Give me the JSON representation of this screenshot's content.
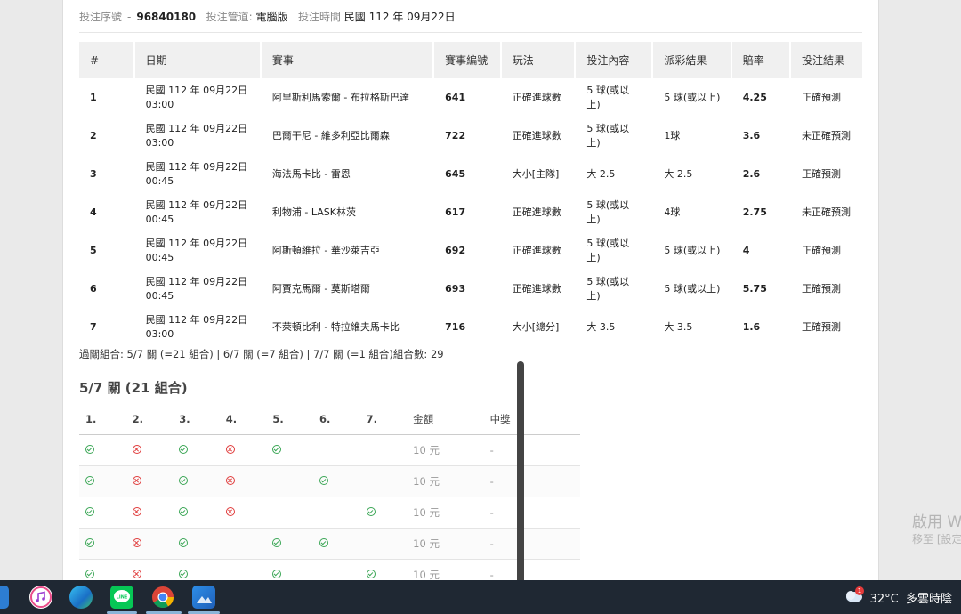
{
  "meta": {
    "bet_no_label": "投注序號",
    "bet_no": "96840180",
    "channel_label": "投注管道",
    "channel": "電腦版",
    "time_label": "投注時間",
    "time": "民國 112 年 09月22日"
  },
  "table": {
    "headers": [
      "#",
      "日期",
      "賽事",
      "賽事編號",
      "玩法",
      "投注內容",
      "派彩結果",
      "賠率",
      "投注結果"
    ],
    "rows": [
      {
        "n": "1",
        "date": "民國 112 年 09月22日",
        "time": "03:00",
        "match": "阿里斯利馬索爾 - 布拉格斯巴達",
        "code": "641",
        "play": "正確進球數",
        "pick": "5 球(或以上)",
        "result": "5 球(或以上)",
        "odds": "4.25",
        "outcome": "正確預測"
      },
      {
        "n": "2",
        "date": "民國 112 年 09月22日",
        "time": "03:00",
        "match": "巴爾干尼 - 維多利亞比爾森",
        "code": "722",
        "play": "正確進球數",
        "pick": "5 球(或以上)",
        "result": "1球",
        "odds": "3.6",
        "outcome": "未正確預測"
      },
      {
        "n": "3",
        "date": "民國 112 年 09月22日",
        "time": "00:45",
        "match": "海法馬卡比 - 雷恩",
        "code": "645",
        "play": "大小[主隊]",
        "pick": "大 2.5",
        "result": "大 2.5",
        "odds": "2.6",
        "outcome": "正確預測"
      },
      {
        "n": "4",
        "date": "民國 112 年 09月22日",
        "time": "00:45",
        "match": "利物浦 - LASK林茨",
        "code": "617",
        "play": "正確進球數",
        "pick": "5 球(或以上)",
        "result": "4球",
        "odds": "2.75",
        "outcome": "未正確預測"
      },
      {
        "n": "5",
        "date": "民國 112 年 09月22日",
        "time": "00:45",
        "match": "阿斯頓維拉 - 華沙萊吉亞",
        "code": "692",
        "play": "正確進球數",
        "pick": "5 球(或以上)",
        "result": "5 球(或以上)",
        "odds": "4",
        "outcome": "正確預測"
      },
      {
        "n": "6",
        "date": "民國 112 年 09月22日",
        "time": "00:45",
        "match": "阿賈克馬爾 - 莫斯塔爾",
        "code": "693",
        "play": "正確進球數",
        "pick": "5 球(或以上)",
        "result": "5 球(或以上)",
        "odds": "5.75",
        "outcome": "正確預測"
      },
      {
        "n": "7",
        "date": "民國 112 年 09月22日",
        "time": "03:00",
        "match": "不萊頓比利 - 特拉維夫馬卡比",
        "code": "716",
        "play": "大小[總分]",
        "pick": "大 3.5",
        "result": "大 3.5",
        "odds": "1.6",
        "outcome": "正確預測"
      }
    ]
  },
  "combo_summary": "過關組合: 5/7 關 (=21 組合) | 6/7 關 (=7 組合) | 7/7 關 (=1 組合)組合數: 29",
  "section_title": "5/7 關 (21 組合)",
  "parlay": {
    "headers": [
      "1.",
      "2.",
      "3.",
      "4.",
      "5.",
      "6.",
      "7.",
      "金額",
      "中獎"
    ],
    "rows": [
      {
        "marks": [
          "ok",
          "no",
          "ok",
          "no",
          "ok",
          "",
          ""
        ],
        "amount": "10 元",
        "prize": "-"
      },
      {
        "marks": [
          "ok",
          "no",
          "ok",
          "no",
          "",
          "ok",
          ""
        ],
        "amount": "10 元",
        "prize": "-"
      },
      {
        "marks": [
          "ok",
          "no",
          "ok",
          "no",
          "",
          "",
          "ok"
        ],
        "amount": "10 元",
        "prize": "-"
      },
      {
        "marks": [
          "ok",
          "no",
          "ok",
          "",
          "ok",
          "ok",
          ""
        ],
        "amount": "10 元",
        "prize": "-"
      },
      {
        "marks": [
          "ok",
          "no",
          "ok",
          "",
          "ok",
          "",
          "ok"
        ],
        "amount": "10 元",
        "prize": "-"
      }
    ]
  },
  "watermark": {
    "line1": "啟用 W",
    "line2": "移至 [設定"
  },
  "taskbar": {
    "temperature": "32°C",
    "weather": "多雲時陰",
    "notification_count": "1",
    "apps": [
      "explorer-icon",
      "itunes-icon",
      "edge-icon",
      "line-icon",
      "chrome-icon",
      "photos-icon"
    ]
  }
}
